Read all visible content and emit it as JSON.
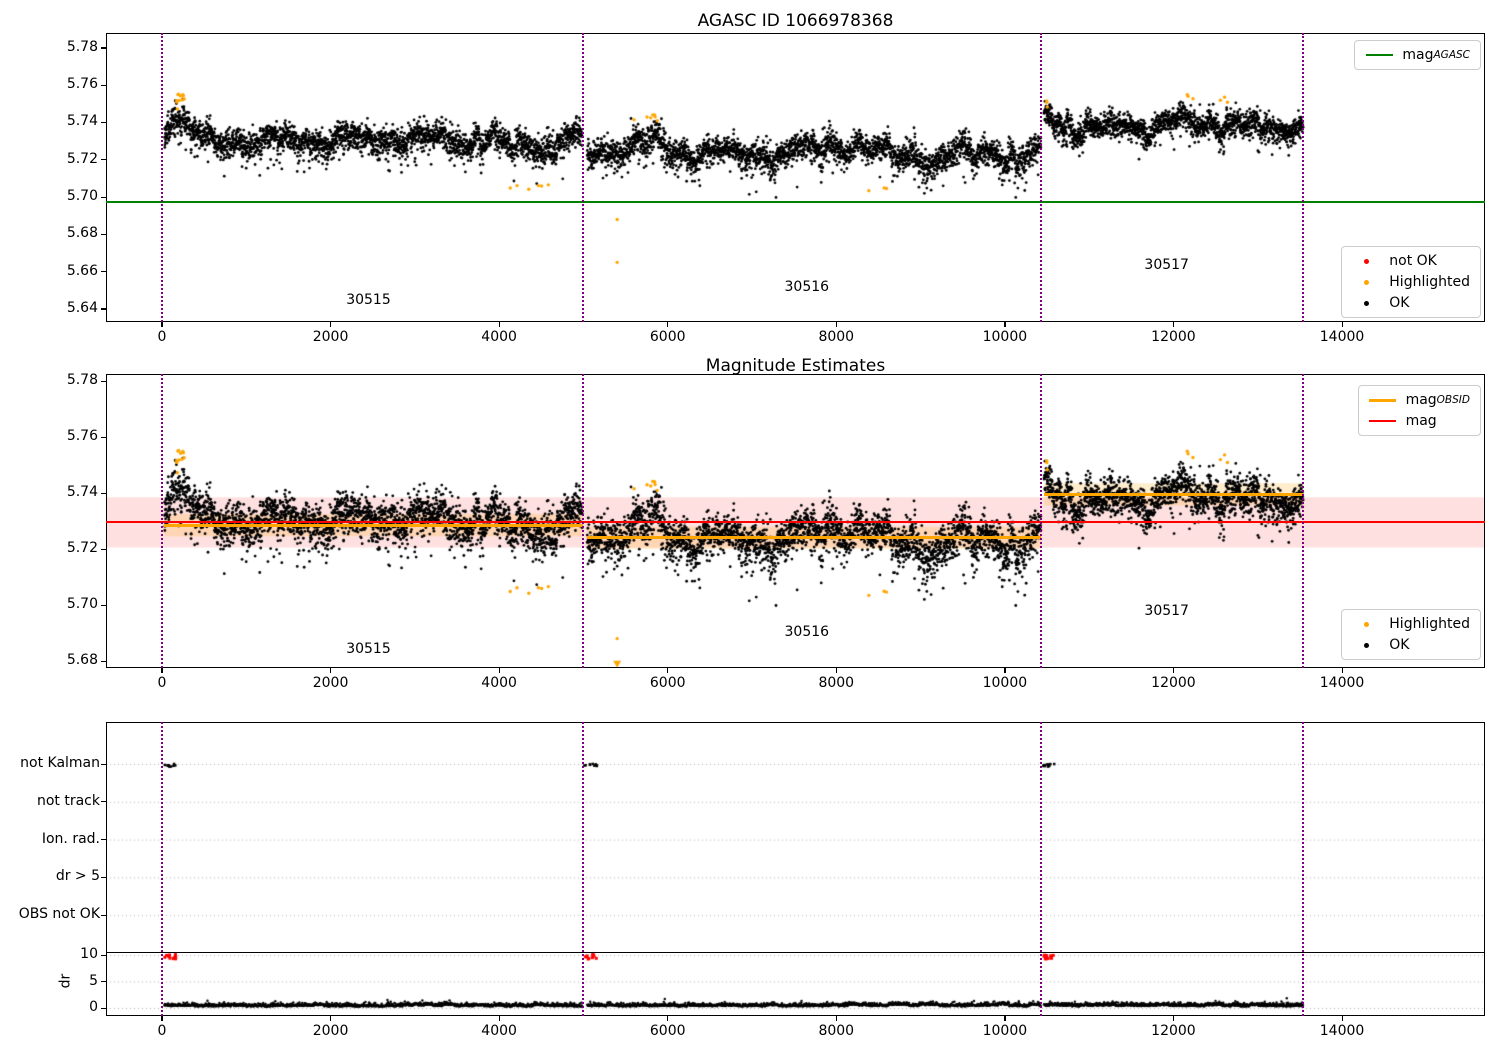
{
  "colors": {
    "ok": "#000000",
    "highlighted": "#ffa500",
    "not_ok": "#ff0000",
    "agasc_mag": "#008000",
    "mag": "#ff0000",
    "mag_obsid": "#ffa500",
    "obsid_boundary": "#800080",
    "mag_band": "rgba(255,0,0,0.12)",
    "obsid_band": "rgba(255,165,0,0.20)",
    "grid": "#b5b5b5",
    "frame": "#000000"
  },
  "chart_data": [
    {
      "id": "agasc_panel",
      "type": "scatter",
      "title": "AGASC ID 1066978368",
      "xlim": [
        -664,
        15696
      ],
      "ylim": [
        5.633,
        5.788
      ],
      "xticks": [
        0,
        2000,
        4000,
        6000,
        8000,
        10000,
        12000,
        14000
      ],
      "yticks": [
        5.64,
        5.66,
        5.68,
        5.7,
        5.72,
        5.74,
        5.76,
        5.78
      ],
      "agasc_mag_line": {
        "y": 5.6975,
        "color": "#008000"
      },
      "obsid_boundaries": [
        0,
        4990,
        10430,
        13540
      ],
      "obsid_annotations": [
        {
          "text": "30515",
          "x": 2450,
          "y": 5.644
        },
        {
          "text": "30516",
          "x": 7650,
          "y": 5.6515
        },
        {
          "text": "30517",
          "x": 11920,
          "y": 5.663
        }
      ],
      "line_legend": {
        "entries": [
          {
            "text": "mag",
            "sub": "AGASC",
            "color": "#008000",
            "lw": 2
          }
        ]
      },
      "marker_legend": {
        "entries": [
          {
            "text": "not OK",
            "color": "#ff0000"
          },
          {
            "text": "Highlighted",
            "color": "#ffa500"
          },
          {
            "text": "OK",
            "color": "#000000"
          }
        ]
      },
      "ok_series": {
        "color": "#000000",
        "segments": [
          {
            "obsid": 30515,
            "x0": 30,
            "x1": 4985,
            "n": 2600,
            "mean": 5.7302,
            "noise": 0.0036,
            "wander": [
              [
                900,
                0.0026
              ],
              [
                310,
                0.0018
              ]
            ],
            "dip_prob": 0.06,
            "dip_max": 0.013,
            "bumps": [
              [
                170,
                110,
                0.0125
              ],
              [
                4400,
                300,
                -0.003
              ]
            ]
          },
          {
            "obsid": 30516,
            "x0": 5045,
            "x1": 10425,
            "n": 2750,
            "mean": 5.7238,
            "noise": 0.0036,
            "wander": [
              [
                950,
                0.0026
              ],
              [
                300,
                0.0018
              ]
            ],
            "dip_prob": 0.07,
            "dip_max": 0.014,
            "bumps": [
              [
                5780,
                180,
                0.0075
              ],
              [
                8150,
                260,
                0.0045
              ],
              [
                9250,
                350,
                -0.003
              ]
            ]
          },
          {
            "obsid": 30517,
            "x0": 10465,
            "x1": 13535,
            "n": 1700,
            "mean": 5.7368,
            "noise": 0.0032,
            "wander": [
              [
                800,
                0.0022
              ],
              [
                280,
                0.0016
              ]
            ],
            "dip_prob": 0.05,
            "dip_max": 0.011,
            "bumps": [
              [
                10505,
                45,
                0.009
              ],
              [
                12300,
                420,
                0.0035
              ]
            ]
          }
        ]
      },
      "highlighted_series": {
        "color": "#ffa500",
        "clusters": [
          [
            120,
            270,
            5.7465,
            5.756,
            11
          ],
          [
            4050,
            4650,
            5.7025,
            5.707,
            6
          ],
          [
            5600,
            5950,
            5.737,
            5.747,
            7
          ],
          [
            8020,
            8710,
            5.702,
            5.705,
            3
          ],
          [
            10480,
            10520,
            5.748,
            5.7555,
            3
          ],
          [
            12150,
            12250,
            5.752,
            5.757,
            3
          ],
          [
            12550,
            12650,
            5.75,
            5.7555,
            3
          ]
        ],
        "points": [
          [
            5400,
            5.688
          ],
          [
            5400,
            5.665
          ]
        ]
      }
    },
    {
      "id": "magnitude_estimates_panel",
      "type": "scatter",
      "title": "Magnitude Estimates",
      "xlim": [
        -664,
        15696
      ],
      "ylim": [
        5.6775,
        5.7825
      ],
      "xticks": [
        0,
        2000,
        4000,
        6000,
        8000,
        10000,
        12000,
        14000
      ],
      "yticks": [
        5.68,
        5.7,
        5.72,
        5.74,
        5.76,
        5.78
      ],
      "mag_line": {
        "y": 5.7295,
        "color": "#ff0000",
        "band": [
          5.7205,
          5.7385
        ]
      },
      "mag_obsid_lines": {
        "color": "#ffa500",
        "band_halfwidth": 0.004,
        "segments": [
          {
            "obsid": 30515,
            "x0": 30,
            "x1": 4990,
            "y": 5.7285
          },
          {
            "obsid": 30516,
            "x0": 5045,
            "x1": 10430,
            "y": 5.724
          },
          {
            "obsid": 30517,
            "x0": 10465,
            "x1": 13540,
            "y": 5.7395
          }
        ]
      },
      "obsid_boundaries": [
        0,
        4990,
        10430,
        13540
      ],
      "obsid_annotations": [
        {
          "text": "30515",
          "x": 2450,
          "y": 5.684
        },
        {
          "text": "30516",
          "x": 7650,
          "y": 5.69
        },
        {
          "text": "30517",
          "x": 11920,
          "y": 5.6975
        }
      ],
      "line_legend": {
        "entries": [
          {
            "text": "mag",
            "sub": "OBSID",
            "color": "#ffa500",
            "lw": 3
          },
          {
            "text": "mag",
            "color": "#ff0000",
            "lw": 2
          }
        ]
      },
      "marker_legend": {
        "entries": [
          {
            "text": "Highlighted",
            "color": "#ffa500"
          },
          {
            "text": "OK",
            "color": "#000000"
          }
        ]
      },
      "reuses_series_of_panel": 0,
      "extra_markers": [
        {
          "type": "triangle-down",
          "x": 5400,
          "y": 5.679,
          "color": "#ffa500"
        }
      ]
    },
    {
      "id": "flags_dr_panel",
      "type": "scatter",
      "xlim": [
        -664,
        15696
      ],
      "xticks": [
        0,
        2000,
        4000,
        6000,
        8000,
        10000,
        12000,
        14000
      ],
      "flag_rows": [
        "not Kalman",
        "not track",
        "Ion. rad.",
        "dr > 5",
        "OBS not OK"
      ],
      "flag_marks": [
        {
          "row": 0,
          "x0": 10,
          "x1": 160
        },
        {
          "row": 0,
          "x0": 4995,
          "x1": 5145
        },
        {
          "row": 0,
          "x0": 10435,
          "x1": 10585
        }
      ],
      "dr_label": "dr",
      "dr_ticks": [
        10,
        5,
        0
      ],
      "dr_limit_line": 10.5,
      "dr_flagged": {
        "value": 10,
        "color": "#ff0000",
        "spans": [
          [
            10,
            150
          ],
          [
            4995,
            5135
          ],
          [
            10435,
            10565
          ]
        ]
      },
      "dr_segments": [
        {
          "x0": 30,
          "x1": 4985,
          "n": 1300,
          "base": 0.5,
          "spread": 0.28
        },
        {
          "x0": 5045,
          "x1": 10425,
          "n": 1400,
          "base": 0.5,
          "spread": 0.28
        },
        {
          "x0": 10465,
          "x1": 13535,
          "n": 900,
          "base": 0.5,
          "spread": 0.28
        }
      ],
      "obsid_boundaries": [
        0,
        4990,
        10430,
        13540
      ]
    }
  ]
}
